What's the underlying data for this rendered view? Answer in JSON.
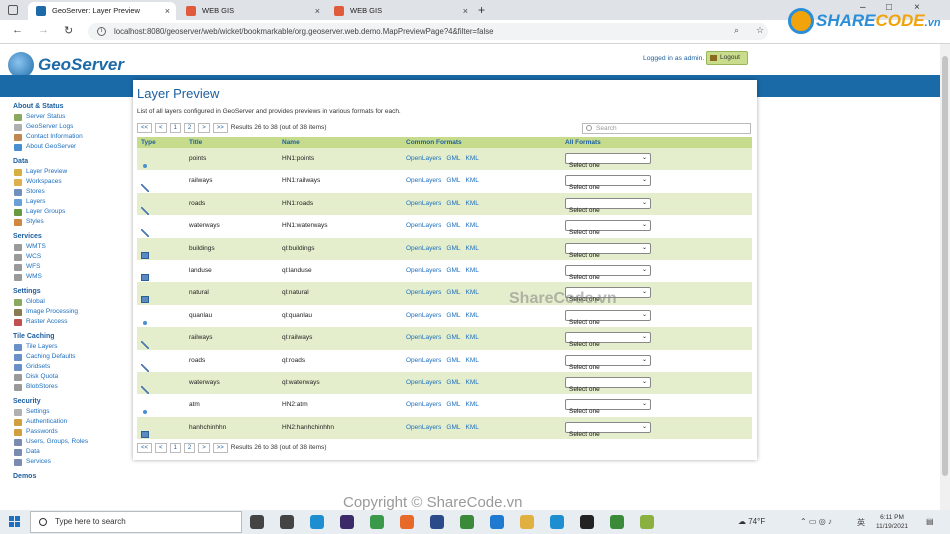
{
  "browser": {
    "tabs": [
      {
        "title": "GeoServer: Layer Preview",
        "active": true,
        "icon_color": "#1d6aa8"
      },
      {
        "title": "WEB GIS",
        "active": false,
        "icon_color": "#e05a3c"
      },
      {
        "title": "WEB GIS",
        "active": false,
        "icon_color": "#e05a3c"
      }
    ],
    "url": "localhost:8080/geoserver/web/wicket/bookmarkable/org.geoserver.web.demo.MapPreviewPage?4&filter=false",
    "new_tab_symbol": "+",
    "window_controls": [
      "–",
      "□",
      "×"
    ]
  },
  "overlay": {
    "sharecode_logo": {
      "prefix": "SHARE",
      "suffix": "CODE",
      "domain": ".vn"
    },
    "watermark": "ShareCode.vn",
    "copyright": "Copyright © ShareCode.vn"
  },
  "header": {
    "app_name": "GeoServer",
    "logged_in_text": "Logged in as admin.",
    "logout_label": "Logout"
  },
  "sidebar": {
    "sections": [
      {
        "title": "About & Status",
        "items": [
          {
            "label": "Server Status",
            "icon": "status-icon",
            "color": "#8aa860"
          },
          {
            "label": "GeoServer Logs",
            "icon": "logs-icon",
            "color": "#b0b0b0"
          },
          {
            "label": "Contact Information",
            "icon": "contact-icon",
            "color": "#c08850"
          },
          {
            "label": "About GeoServer",
            "icon": "info-icon",
            "color": "#4a8fd0"
          }
        ]
      },
      {
        "title": "Data",
        "items": [
          {
            "label": "Layer Preview",
            "icon": "layer-preview-icon",
            "color": "#d4b040"
          },
          {
            "label": "Workspaces",
            "icon": "workspace-icon",
            "color": "#e0b050"
          },
          {
            "label": "Stores",
            "icon": "store-icon",
            "color": "#7090c0"
          },
          {
            "label": "Layers",
            "icon": "layers-icon",
            "color": "#6aa0d8"
          },
          {
            "label": "Layer Groups",
            "icon": "layer-groups-icon",
            "color": "#6a9a40"
          },
          {
            "label": "Styles",
            "icon": "styles-icon",
            "color": "#d08840"
          }
        ]
      },
      {
        "title": "Services",
        "items": [
          {
            "label": "WMTS",
            "icon": "wmts-icon",
            "color": "#9a9a9a"
          },
          {
            "label": "WCS",
            "icon": "wcs-icon",
            "color": "#9a9a9a"
          },
          {
            "label": "WFS",
            "icon": "wfs-icon",
            "color": "#9a9a9a"
          },
          {
            "label": "WMS",
            "icon": "wms-icon",
            "color": "#9a9a9a"
          }
        ]
      },
      {
        "title": "Settings",
        "items": [
          {
            "label": "Global",
            "icon": "global-icon",
            "color": "#8aa860"
          },
          {
            "label": "Image Processing",
            "icon": "image-processing-icon",
            "color": "#8a7a50"
          },
          {
            "label": "Raster Access",
            "icon": "raster-access-icon",
            "color": "#c05050"
          }
        ]
      },
      {
        "title": "Tile Caching",
        "items": [
          {
            "label": "Tile Layers",
            "icon": "tile-layers-icon",
            "color": "#6a90c8"
          },
          {
            "label": "Caching Defaults",
            "icon": "caching-defaults-icon",
            "color": "#6a90c8"
          },
          {
            "label": "Gridsets",
            "icon": "gridsets-icon",
            "color": "#6a90c8"
          },
          {
            "label": "Disk Quota",
            "icon": "disk-quota-icon",
            "color": "#9a9a9a"
          },
          {
            "label": "BlobStores",
            "icon": "blobstores-icon",
            "color": "#9a9a9a"
          }
        ]
      },
      {
        "title": "Security",
        "items": [
          {
            "label": "Settings",
            "icon": "security-settings-icon",
            "color": "#b0b0b0"
          },
          {
            "label": "Authentication",
            "icon": "authentication-icon",
            "color": "#d0a040"
          },
          {
            "label": "Passwords",
            "icon": "passwords-icon",
            "color": "#d0a040"
          },
          {
            "label": "Users, Groups, Roles",
            "icon": "users-icon",
            "color": "#7a8ab0"
          },
          {
            "label": "Data",
            "icon": "data-security-icon",
            "color": "#7a8ab0"
          },
          {
            "label": "Services",
            "icon": "services-security-icon",
            "color": "#7a8ab0"
          }
        ]
      },
      {
        "title": "Demos",
        "items": []
      }
    ]
  },
  "main": {
    "title": "Layer Preview",
    "description": "List of all layers configured in GeoServer and provides previews in various formats for each.",
    "pager": {
      "buttons": [
        "<<",
        "<",
        "1",
        "2",
        ">",
        ">>"
      ],
      "info": "Results 26 to 38 (out of 38 items)"
    },
    "search_placeholder": "Search",
    "columns": {
      "type": "Type",
      "title": "Title",
      "name": "Name",
      "common_formats": "Common Formats",
      "all_formats": "All Formats"
    },
    "formats": [
      "OpenLayers",
      "GML",
      "KML"
    ],
    "select_default": "Select one",
    "rows": [
      {
        "type": "point",
        "title": "points",
        "name": "HN1:points"
      },
      {
        "type": "line",
        "title": "railways",
        "name": "HN1:railways"
      },
      {
        "type": "line",
        "title": "roads",
        "name": "HN1:roads"
      },
      {
        "type": "line",
        "title": "waterways",
        "name": "HN1:waterways"
      },
      {
        "type": "polygon",
        "title": "buildings",
        "name": "ql:buildings"
      },
      {
        "type": "polygon",
        "title": "landuse",
        "name": "ql:landuse"
      },
      {
        "type": "polygon",
        "title": "natural",
        "name": "ql:natural"
      },
      {
        "type": "point",
        "title": "quanlau",
        "name": "ql:quanlau"
      },
      {
        "type": "line",
        "title": "railways",
        "name": "ql:railways"
      },
      {
        "type": "line",
        "title": "roads",
        "name": "ql:roads"
      },
      {
        "type": "line",
        "title": "waterways",
        "name": "ql:waterways"
      },
      {
        "type": "point",
        "title": "atm",
        "name": "HN2:atm"
      },
      {
        "type": "polygon",
        "title": "hanhchinhhn",
        "name": "HN2:hanhchinhhn"
      }
    ]
  },
  "taskbar": {
    "search_placeholder": "Type here to search",
    "apps": [
      {
        "name": "task-view-icon",
        "color": "#444444"
      },
      {
        "name": "widgets-icon",
        "color": "#444444"
      },
      {
        "name": "edge-icon",
        "color": "#1d8fd0"
      },
      {
        "name": "eclipse-icon",
        "color": "#3a2a6a"
      },
      {
        "name": "recycle-app-icon",
        "color": "#3a9a4a"
      },
      {
        "name": "postman-icon",
        "color": "#e86a2a"
      },
      {
        "name": "ssms-icon",
        "color": "#2a4a8a"
      },
      {
        "name": "node-icon",
        "color": "#3a8a3a"
      },
      {
        "name": "vscode-icon",
        "color": "#1d7ad0"
      },
      {
        "name": "file-explorer-icon",
        "color": "#e0b040"
      },
      {
        "name": "zalo-icon",
        "color": "#1d8fd0"
      },
      {
        "name": "terminal-icon",
        "color": "#222222"
      },
      {
        "name": "app-green-icon",
        "color": "#3a8a3a"
      },
      {
        "name": "qgis-icon",
        "color": "#8ab040"
      }
    ],
    "weather": "74°F",
    "time": "6:11 PM",
    "date": "11/19/2021"
  }
}
